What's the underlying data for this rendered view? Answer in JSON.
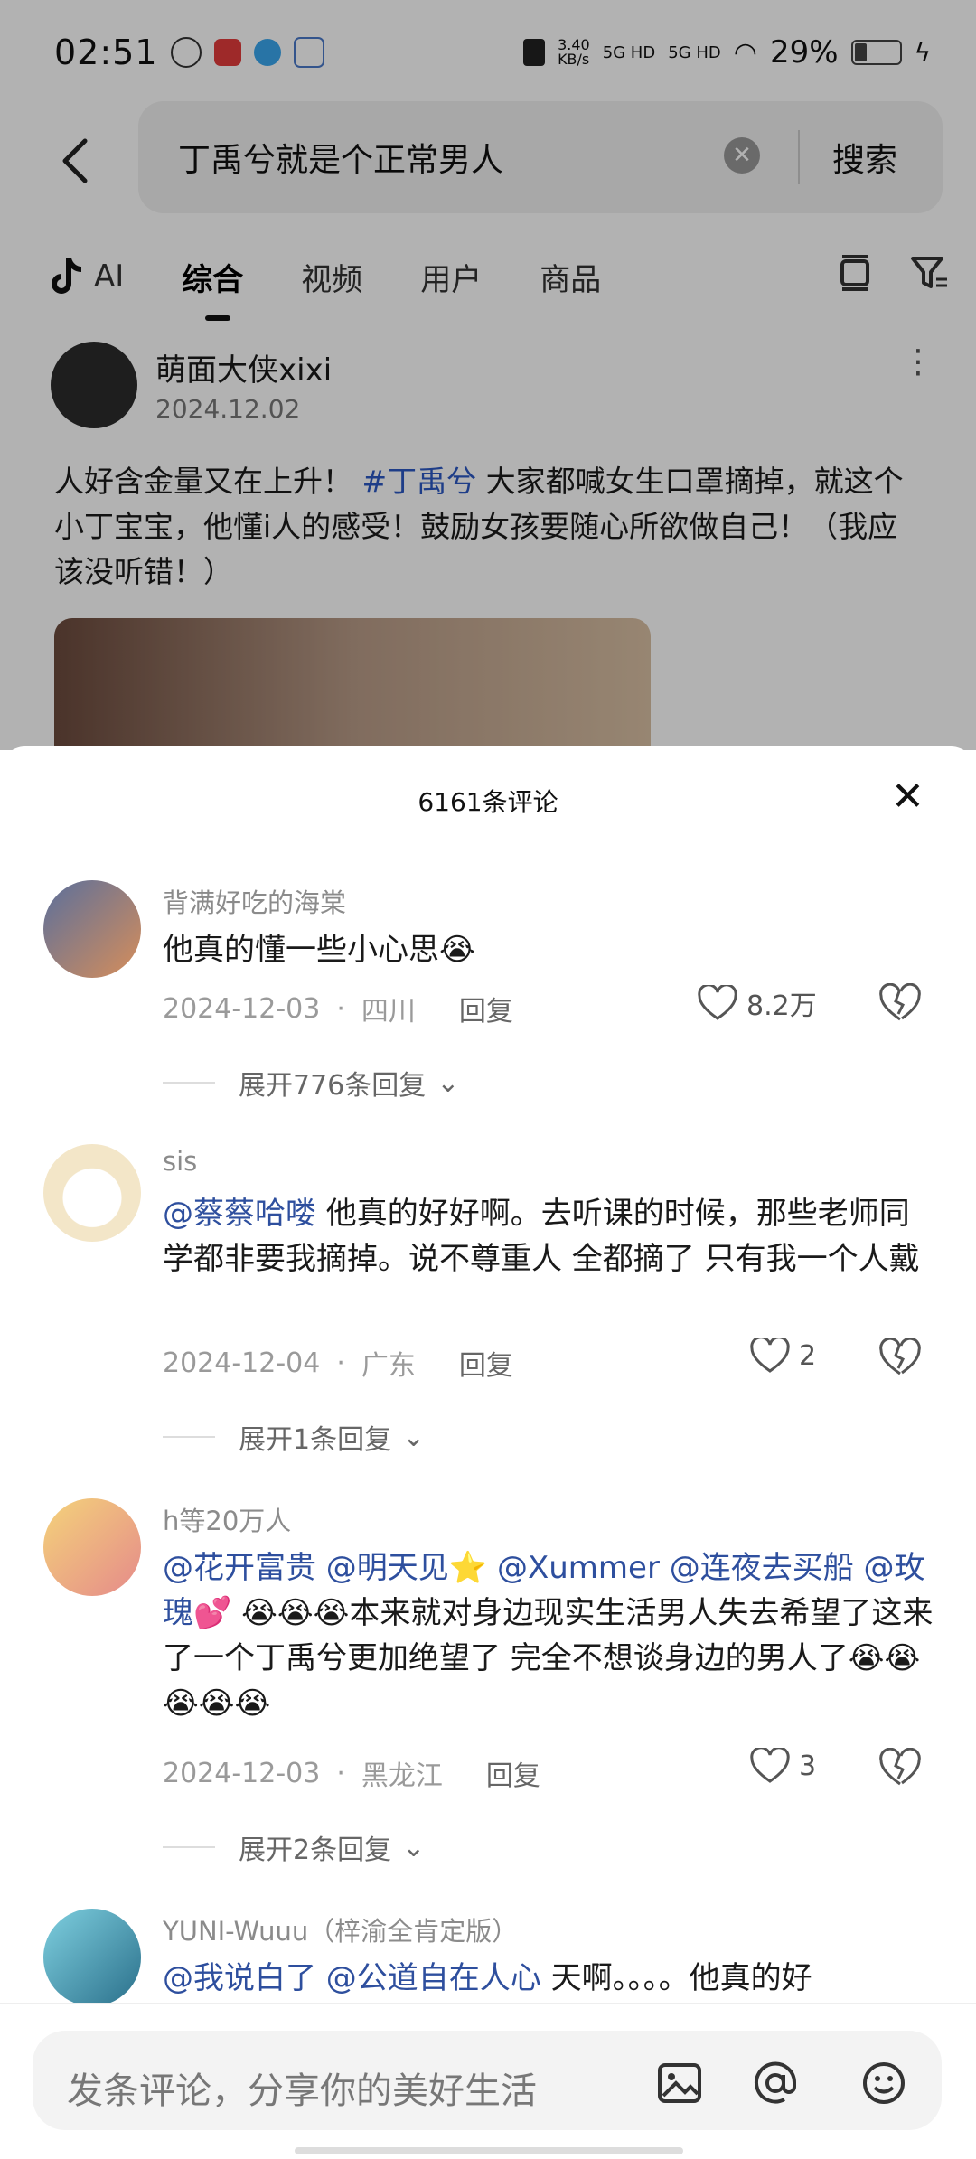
{
  "status_bar": {
    "time": "02:51",
    "net_speed": "3.40\nKB/s",
    "signal1": "5G HD",
    "signal2": "5G HD",
    "battery": "29%"
  },
  "search": {
    "query": "丁禹兮就是个正常男人",
    "button": "搜索"
  },
  "tabs": {
    "ai": "AI",
    "items": [
      "综合",
      "视频",
      "用户",
      "商品"
    ],
    "active": 0
  },
  "post": {
    "author": "萌面大侠xixi",
    "date": "2024.12.02",
    "text_before": "人好含金量又在上升！ ",
    "hashtag": "#丁禹兮",
    "text_after": " 大家都喊女生口罩摘掉，就这个小丁宝宝，他懂i人的感受！鼓励女孩要随心所欲做自己！（我应该没听错！）"
  },
  "comments_sheet": {
    "title": "6161条评论",
    "comments": [
      {
        "name": "背满好吃的海棠",
        "mention": "",
        "text": "他真的懂一些小心思😭",
        "date": "2024-12-03",
        "region": "四川",
        "reply": "回复",
        "likes": "8.2万",
        "expand": "展开776条回复"
      },
      {
        "name": "sis",
        "mention": "@蔡蔡哈喽",
        "text": " 他真的好好啊。去听课的时候，那些老师同学都非要我摘掉。说不尊重人   全都摘了  只有我一个人戴",
        "date": "2024-12-04",
        "region": "广东",
        "reply": "回复",
        "likes": "2",
        "expand": "展开1条回复"
      },
      {
        "name": "h等20万人",
        "mention": "@花开富贵 @明天见⭐ @Xummer @连夜去买船 @玫瑰💕",
        "text": " 😭😭😭本来就对身边现实生活男人失去希望了这来了一个丁禹兮更加绝望了 完全不想谈身边的男人了😭😭😭😭😭",
        "date": "2024-12-03",
        "region": "黑龙江",
        "reply": "回复",
        "likes": "3",
        "expand": "展开2条回复"
      },
      {
        "name": "YUNI-Wuuu（梓渝全肯定版）",
        "mention": "@我说白了 @公道自在人心",
        "text": " 天啊。。。。他真的好",
        "date": "",
        "region": "",
        "reply": "",
        "likes": "",
        "expand": ""
      }
    ]
  },
  "input_bar": {
    "placeholder": "发条评论，分享你的美好生活"
  },
  "colors": {
    "mention": "#2e4f9e",
    "hashtag": "#2b58c3"
  }
}
